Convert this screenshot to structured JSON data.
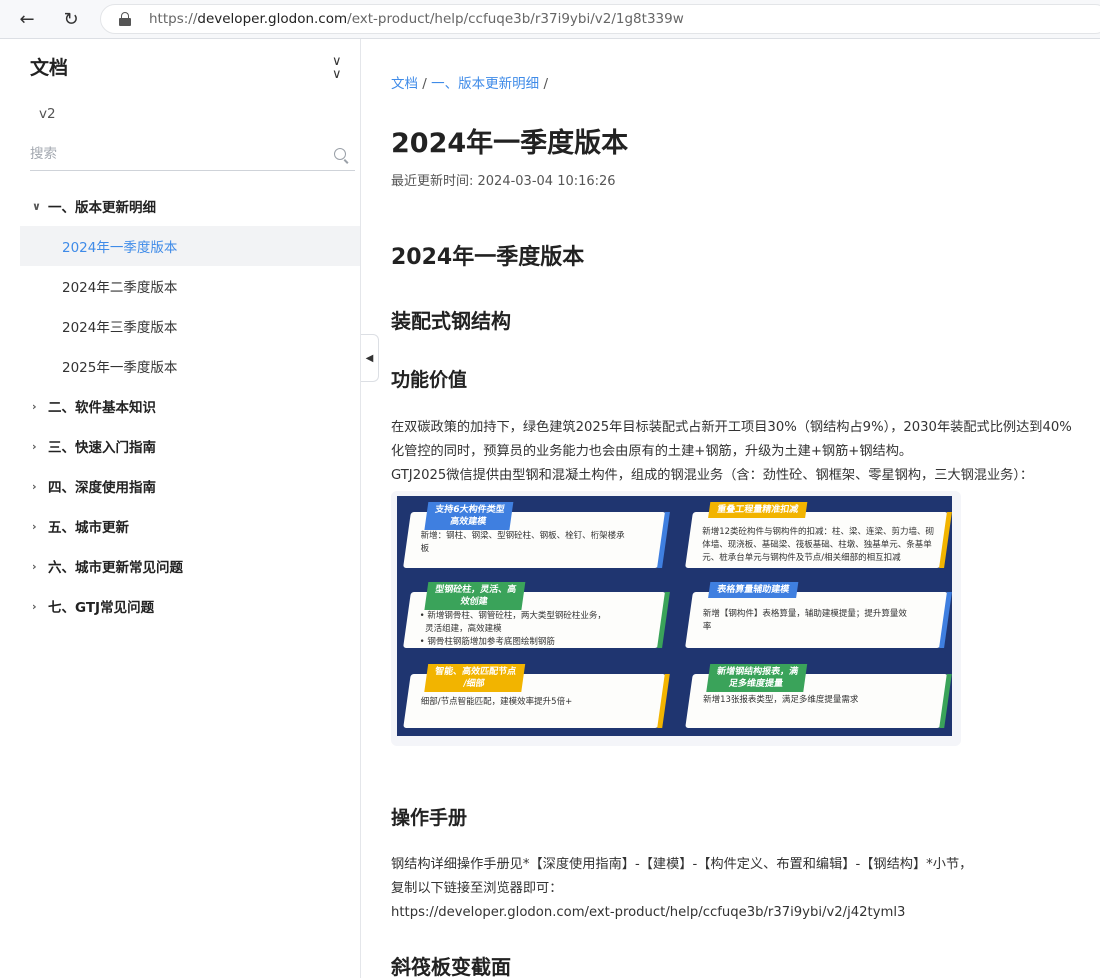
{
  "browser": {
    "url_prefix": "https://",
    "url_host": "developer.glodon.com",
    "url_path": "/ext-product/help/ccfuqe3b/r37i9ybi/v2/1g8t339w"
  },
  "sidebar": {
    "title": "文档",
    "version": "v2",
    "search_placeholder": "搜索",
    "items": [
      {
        "label": "一、版本更新明细",
        "expanded": true
      },
      {
        "label": "2024年一季度版本",
        "active": true
      },
      {
        "label": "2024年二季度版本"
      },
      {
        "label": "2024年三季度版本"
      },
      {
        "label": "2025年一季度版本"
      },
      {
        "label": "二、软件基本知识"
      },
      {
        "label": "三、快速入门指南"
      },
      {
        "label": "四、深度使用指南"
      },
      {
        "label": "五、城市更新"
      },
      {
        "label": "六、城市更新常见问题"
      },
      {
        "label": "七、GTJ常见问题"
      }
    ]
  },
  "main": {
    "breadcrumb": [
      "文档",
      "一、版本更新明细"
    ],
    "breadcrumb_sep": "/",
    "title": "2024年一季度版本",
    "updated": "最近更新时间: 2024-03-04 10:16:26",
    "h1": "2024年一季度版本",
    "h2": "装配式钢结构",
    "h3": "功能价值",
    "para1_line1": "在双碳政策的加持下，绿色建筑2025年目标装配式占新开工项目30%（钢结构占9%），2030年装配式比例达到40%",
    "para1_line2": "化管控的同时，预算员的业务能力也会由原有的土建+钢筋，升级为土建+钢筋+钢结构。",
    "para1_line3": "GTJ2025微信提供由型钢和混凝土构件，组成的钢混业务（含：劲性砼、钢框架、零星钢构，三大钢混业务）：",
    "figure": {
      "cards": [
        {
          "tag": "支持6大构件类型\n高效建模",
          "text": "新增：钢柱、钢梁、型钢砼柱、钢板、栓钉、桁架楼承\n板",
          "accent": "#3f7fe0"
        },
        {
          "tag": "重叠工程量精准扣减",
          "text": "新增12类砼构件与钢构件的扣减：柱、梁、连梁、剪力墙、砌\n体墙、现浇板、基础梁、筏板基础、柱墩、独基单元、条基单\n元、桩承台单元与钢构件及节点/相关细部的相互扣减",
          "accent": "#f2b400"
        },
        {
          "tag": "型钢砼柱，灵活、高\n效创建",
          "text": "• 新增钢骨柱、钢管砼柱，两大类型钢砼柱业务，\n  灵活组建，高效建模\n• 钢骨柱钢筋增加参考底图绘制钢筋",
          "accent": "#3aa35a"
        },
        {
          "tag": "表格算量辅助建模",
          "text": "新增【钢构件】表格算量，辅助建模提量；提升算量效\n率",
          "accent": "#3f7fe0"
        },
        {
          "tag": "智能、高效匹配节点\n/细部",
          "text": "细部/节点智能匹配，建模效率提升5倍+",
          "accent": "#f2b400"
        },
        {
          "tag": "新增钢结构报表，满\n足多维度提量",
          "text": "新增13张报表类型，满足多维度提量需求",
          "accent": "#3aa35a"
        }
      ]
    },
    "h_operation": "操作手册",
    "op_line1": "钢结构详细操作手册见*【深度使用指南】-【建模】-【构件定义、布置和编辑】-【钢结构】*小节，",
    "op_line2": "复制以下链接至浏览器即可：",
    "op_line3": "https://developer.glodon.com/ext-product/help/ccfuqe3b/r37i9ybi/v2/j42tyml3",
    "h_last": "斜筏板变截面"
  },
  "colors": {
    "accent_blue": "#3f8be8",
    "figure_bg": "#1f3570"
  }
}
